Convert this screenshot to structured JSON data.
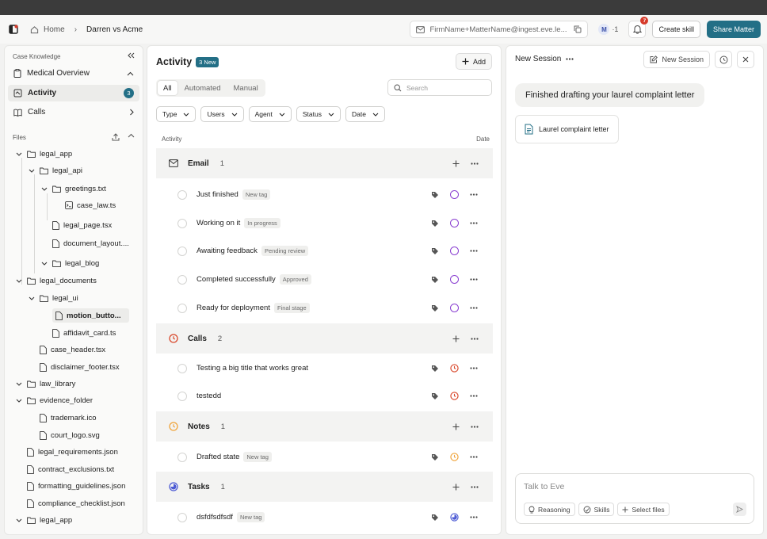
{
  "header": {
    "breadcrumb": {
      "home": "Home",
      "current": "Darren vs Acme"
    },
    "email": "FirmName+MatterName@ingest.eve.le...",
    "avatar": {
      "initial": "M",
      "count": "·1"
    },
    "notifications_badge": "7",
    "create_skill": "Create skill",
    "share_matter": "Share Matter"
  },
  "sidebar": {
    "section_title": "Case Knowledge",
    "items": [
      {
        "label": "Medical Overview",
        "icon": "clipboard-icon"
      },
      {
        "label": "Activity",
        "icon": "activity-icon",
        "count": "3"
      },
      {
        "label": "Calls",
        "icon": "book-icon"
      }
    ],
    "files_title": "Files",
    "tree": [
      {
        "label": "legal_app",
        "type": "folder"
      },
      {
        "label": "legal_api",
        "type": "folder"
      },
      {
        "label": "greetings.txt",
        "type": "folder"
      },
      {
        "label": "case_law.ts",
        "type": "ts"
      },
      {
        "label": "legal_page.tsx",
        "type": "file"
      },
      {
        "label": "document_layout....",
        "type": "file"
      },
      {
        "label": "legal_blog",
        "type": "folder"
      },
      {
        "label": "legal_documents",
        "type": "folder"
      },
      {
        "label": "legal_ui",
        "type": "folder"
      },
      {
        "label": "motion_butto...",
        "type": "file"
      },
      {
        "label": "affidavit_card.ts",
        "type": "file"
      },
      {
        "label": "case_header.tsx",
        "type": "file"
      },
      {
        "label": "disclaimer_footer.tsx",
        "type": "file"
      },
      {
        "label": "law_library",
        "type": "folder"
      },
      {
        "label": "evidence_folder",
        "type": "folder"
      },
      {
        "label": "trademark.ico",
        "type": "file"
      },
      {
        "label": "court_logo.svg",
        "type": "file"
      },
      {
        "label": "legal_requirements.json",
        "type": "file"
      },
      {
        "label": "contract_exclusions.txt",
        "type": "file"
      },
      {
        "label": "formatting_guidelines.json",
        "type": "file"
      },
      {
        "label": "compliance_checklist.json",
        "type": "file"
      },
      {
        "label": "legal_app",
        "type": "folder"
      }
    ]
  },
  "activity": {
    "title": "Activity",
    "new_badge": "3 New",
    "add_label": "Add",
    "tabs": [
      "All",
      "Automated",
      "Manual"
    ],
    "search_placeholder": "Search",
    "filters": [
      "Type",
      "Users",
      "Agent",
      "Status",
      "Date"
    ],
    "col_activity": "Activity",
    "col_date": "Date",
    "groups": [
      {
        "name": "Email",
        "count": "1",
        "color": "#333333",
        "rows": [
          {
            "title": "Just finished",
            "tag": "New tag"
          },
          {
            "title": "Working on it",
            "tag": "In progress"
          },
          {
            "title": "Awaiting feedback",
            "tag": "Pending review"
          },
          {
            "title": "Completed successfully",
            "tag": "Approved"
          },
          {
            "title": "Ready for deployment",
            "tag": "Final stage"
          }
        ]
      },
      {
        "name": "Calls",
        "count": "2",
        "color": "#d9482b",
        "rows": [
          {
            "title": "Testing a big title that works great",
            "tag": ""
          },
          {
            "title": "testedd",
            "tag": ""
          }
        ]
      },
      {
        "name": "Notes",
        "count": "1",
        "color": "#f0a43a",
        "rows": [
          {
            "title": "Drafted state",
            "tag": "New tag"
          }
        ]
      },
      {
        "name": "Tasks",
        "count": "1",
        "color": "#4d5bd4",
        "rows": [
          {
            "title": "dsfdfsdfsdf",
            "tag": "New tag"
          }
        ]
      }
    ]
  },
  "session": {
    "title": "New Session",
    "new_session_label": "New Session",
    "message": "Finished drafting your laurel complaint letter",
    "doc_title": "Laurel complaint letter",
    "composer_placeholder": "Talk to Eve",
    "chips": [
      "Reasoning",
      "Skills",
      "Select files"
    ]
  },
  "colors": {
    "accent": "#236f86",
    "email_status": "#8a3fd1",
    "calls": "#d9482b",
    "notes": "#f0a43a",
    "tasks": "#4d5bd4"
  }
}
